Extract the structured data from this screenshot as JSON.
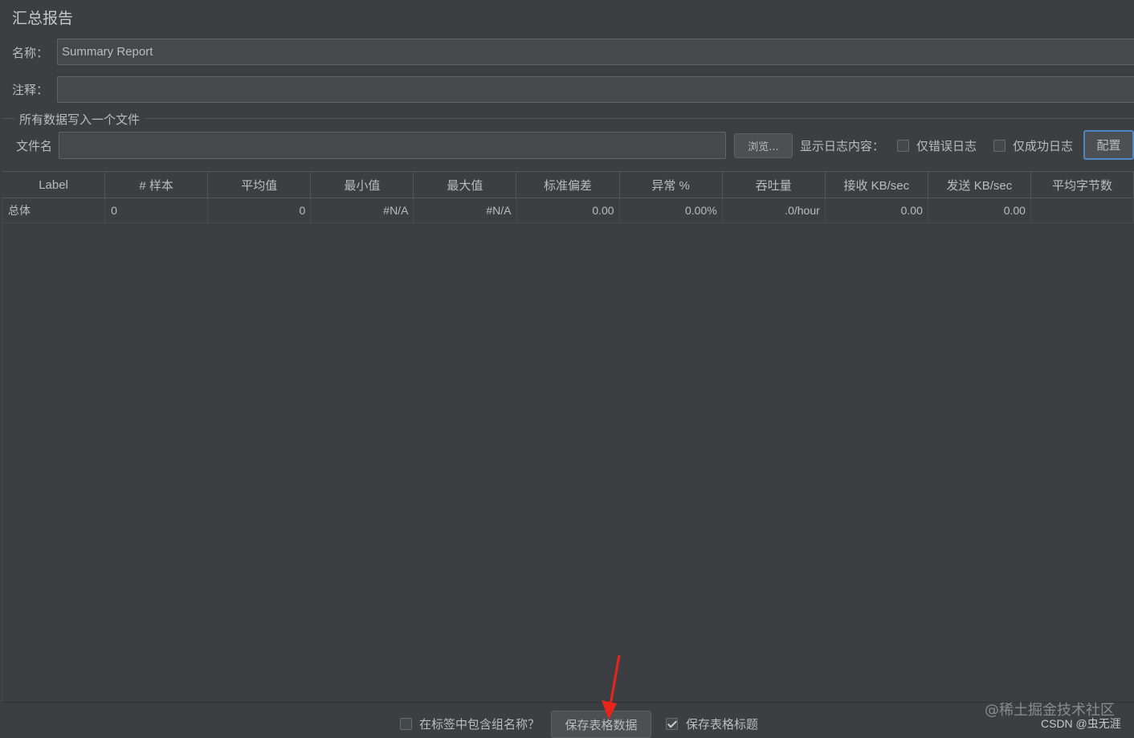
{
  "panel": {
    "title": "汇总报告"
  },
  "form": {
    "name_label": "名称：",
    "name_value": "Summary Report",
    "comment_label": "注释：",
    "comment_value": ""
  },
  "file_group": {
    "legend": "所有数据写入一个文件",
    "filename_label": "文件名",
    "filename_value": "",
    "browse_label": "浏览...",
    "log_display_label": "显示日志内容：",
    "errors_only_label": "仅错误日志",
    "errors_only_checked": false,
    "success_only_label": "仅成功日志",
    "success_only_checked": false,
    "configure_label": "配置"
  },
  "table": {
    "headers": [
      "Label",
      "# 样本",
      "平均值",
      "最小值",
      "最大值",
      "标准偏差",
      "异常 %",
      "吞吐量",
      "接收 KB/sec",
      "发送 KB/sec",
      "平均字节数"
    ],
    "rows": [
      [
        "总体",
        "0",
        "0",
        "#N/A",
        "#N/A",
        "0.00",
        "0.00%",
        ".0/hour",
        "0.00",
        "0.00",
        ""
      ]
    ]
  },
  "footer": {
    "include_group_label": "在标签中包含组名称？",
    "include_group_checked": false,
    "save_table_label": "保存表格数据",
    "save_header_label": "保存表格标题",
    "save_header_checked": true
  },
  "watermark": {
    "line1": "@稀土掘金技术社区",
    "line2": "CSDN @虫无涯"
  },
  "colors": {
    "background": "#3c3f41",
    "text": "#bbbbbb",
    "focus": "#4a88c7",
    "arrow": "#e8251d"
  }
}
